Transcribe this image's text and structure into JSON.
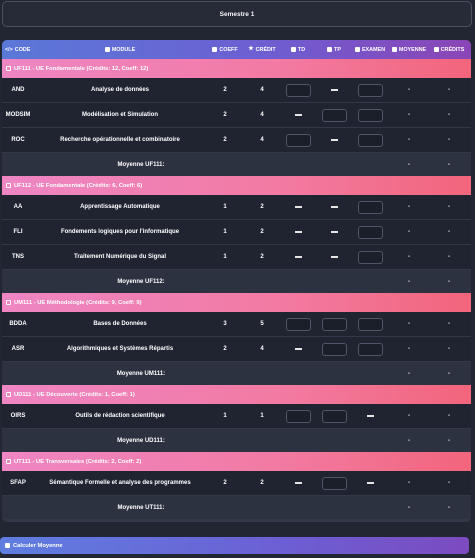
{
  "semester_title": "Semestre 1",
  "headers": {
    "code": "CODE",
    "module": "MODULE",
    "coeff": "COEFF",
    "credit": "CRÉDIT",
    "td": "TD",
    "tp": "TP",
    "examen": "EXAMEN",
    "moyenne": "MOYENNE",
    "credits": "CRÉDITS"
  },
  "ues": [
    {
      "title": "UF111 - UE Fondamentale (Crédits: 12, Coeff: 12)",
      "modules": [
        {
          "code": "AND",
          "name": "Analyse de données",
          "coeff": "2",
          "credit": "4",
          "td": true,
          "tp": false,
          "exam": true,
          "moy": "-",
          "cred": "-"
        },
        {
          "code": "MODSIM",
          "name": "Modélisation et Simulation",
          "coeff": "2",
          "credit": "4",
          "td": false,
          "tp": true,
          "exam": true,
          "moy": "-",
          "cred": "-"
        },
        {
          "code": "ROC",
          "name": "Recherche opérationnelle et combinatoire",
          "coeff": "2",
          "credit": "4",
          "td": true,
          "tp": false,
          "exam": true,
          "moy": "-",
          "cred": "-"
        }
      ],
      "average_label": "Moyenne UF111:",
      "average": "-",
      "average_credits": "-"
    },
    {
      "title": "UF112 - UE Fondamentale (Crédits: 6, Coeff: 6)",
      "modules": [
        {
          "code": "AA",
          "name": "Apprentissage Automatique",
          "coeff": "1",
          "credit": "2",
          "td": false,
          "tp": false,
          "exam": true,
          "moy": "-",
          "cred": "-"
        },
        {
          "code": "FLI",
          "name": "Fondements logiques pour l'informatique",
          "coeff": "1",
          "credit": "2",
          "td": false,
          "tp": false,
          "exam": true,
          "moy": "-",
          "cred": "-"
        },
        {
          "code": "TNS",
          "name": "Traitement Numérique du Signal",
          "coeff": "1",
          "credit": "2",
          "td": false,
          "tp": false,
          "exam": true,
          "moy": "-",
          "cred": "-"
        }
      ],
      "average_label": "Moyenne UF112:",
      "average": "-",
      "average_credits": "-"
    },
    {
      "title": "UM111 - UE Méthodologie (Crédits: 9, Coeff: 9)",
      "modules": [
        {
          "code": "BDDA",
          "name": "Bases de Données",
          "coeff": "3",
          "credit": "5",
          "td": true,
          "tp": true,
          "exam": true,
          "moy": "-",
          "cred": "-"
        },
        {
          "code": "ASR",
          "name": "Algorithmiques et Systèmes Répartis",
          "coeff": "2",
          "credit": "4",
          "td": false,
          "tp": true,
          "exam": true,
          "moy": "-",
          "cred": "-"
        }
      ],
      "average_label": "Moyenne UM111:",
      "average": "-",
      "average_credits": "-"
    },
    {
      "title": "UD111 - UE Découverte (Crédits: 1, Coeff: 1)",
      "modules": [
        {
          "code": "OIRS",
          "name": "Outils de rédaction scientifique",
          "coeff": "1",
          "credit": "1",
          "td": true,
          "tp": true,
          "exam": false,
          "moy": "-",
          "cred": "-"
        }
      ],
      "average_label": "Moyenne UD111:",
      "average": "-",
      "average_credits": "-"
    },
    {
      "title": "UT111 - UE Transversales (Crédits: 2, Coeff: 2)",
      "modules": [
        {
          "code": "SFAP",
          "name": "Sémantique Formelle et analyse des programmes",
          "coeff": "2",
          "credit": "2",
          "td": false,
          "tp": true,
          "exam": false,
          "moy": "-",
          "cred": "-"
        }
      ],
      "average_label": "Moyenne UT111:",
      "average": "-",
      "average_credits": "-"
    }
  ],
  "calculate_button": "Calculer Moyenne"
}
